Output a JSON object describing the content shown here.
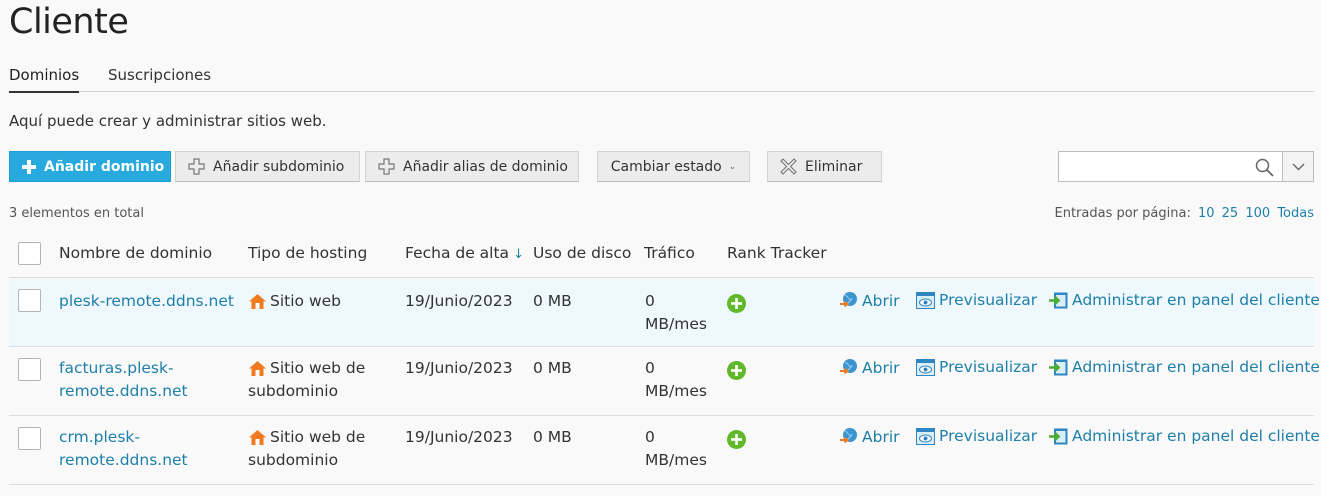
{
  "page": {
    "title": "Cliente",
    "description": "Aquí puede crear y administrar sitios web."
  },
  "tabs": [
    {
      "label": "Dominios",
      "active": true
    },
    {
      "label": "Suscripciones",
      "active": false
    }
  ],
  "toolbar": {
    "add_domain": "Añadir dominio",
    "add_subdomain": "Añadir subdominio",
    "add_alias": "Añadir alias de dominio",
    "change_status": "Cambiar estado",
    "delete": "Eliminar"
  },
  "search": {
    "value": "",
    "placeholder": ""
  },
  "list": {
    "total": "3 elementos en total",
    "per_page_label": "Entradas por página:",
    "per_page_options": [
      "10",
      "25",
      "100",
      "Todas"
    ]
  },
  "columns": {
    "name": "Nombre de dominio",
    "hosting": "Tipo de hosting",
    "date": "Fecha de alta",
    "date_sort": "↓",
    "disk": "Uso de disco",
    "traffic": "Tráfico",
    "rank": "Rank Tracker"
  },
  "rows": [
    {
      "name_lines": [
        "plesk-remote.ddns.net"
      ],
      "hosting_lines": [
        "Sitio web"
      ],
      "date": "19/Junio/2023",
      "disk": "0 MB",
      "traffic_lines": [
        "0",
        "MB/mes"
      ],
      "actions": [
        "Abrir",
        "Previsualizar",
        "Administrar en panel del cliente"
      ]
    },
    {
      "name_lines": [
        "facturas.plesk-",
        "remote.ddns.net"
      ],
      "hosting_lines": [
        "Sitio web de",
        "subdominio"
      ],
      "date": "19/Junio/2023",
      "disk": "0 MB",
      "traffic_lines": [
        "0",
        "MB/mes"
      ],
      "actions": [
        "Abrir",
        "Previsualizar",
        "Administrar en panel del cliente"
      ]
    },
    {
      "name_lines": [
        "crm.plesk-",
        "remote.ddns.net"
      ],
      "hosting_lines": [
        "Sitio web de",
        "subdominio"
      ],
      "date": "19/Junio/2023",
      "disk": "0 MB",
      "traffic_lines": [
        "0",
        "MB/mes"
      ],
      "actions": [
        "Abrir",
        "Previsualizar",
        "Administrar en panel del cliente"
      ]
    }
  ],
  "colors": {
    "primary": "#28aade",
    "link": "#1e7fa8",
    "row_highlight": "#eef8fd",
    "rank_plus": "#62b82b",
    "home_icon": "#f07a1f"
  },
  "icons": {
    "add_domain": "plus-icon",
    "add_subdomain": "plus-outline-icon",
    "add_alias": "plus-outline-icon",
    "delete": "x-outline-icon",
    "search": "magnifier-icon",
    "hosting": "home-icon",
    "rank": "plus-circle-icon",
    "open": "globe-arrow-icon",
    "preview": "eye-window-icon",
    "manage": "panel-arrow-icon"
  }
}
